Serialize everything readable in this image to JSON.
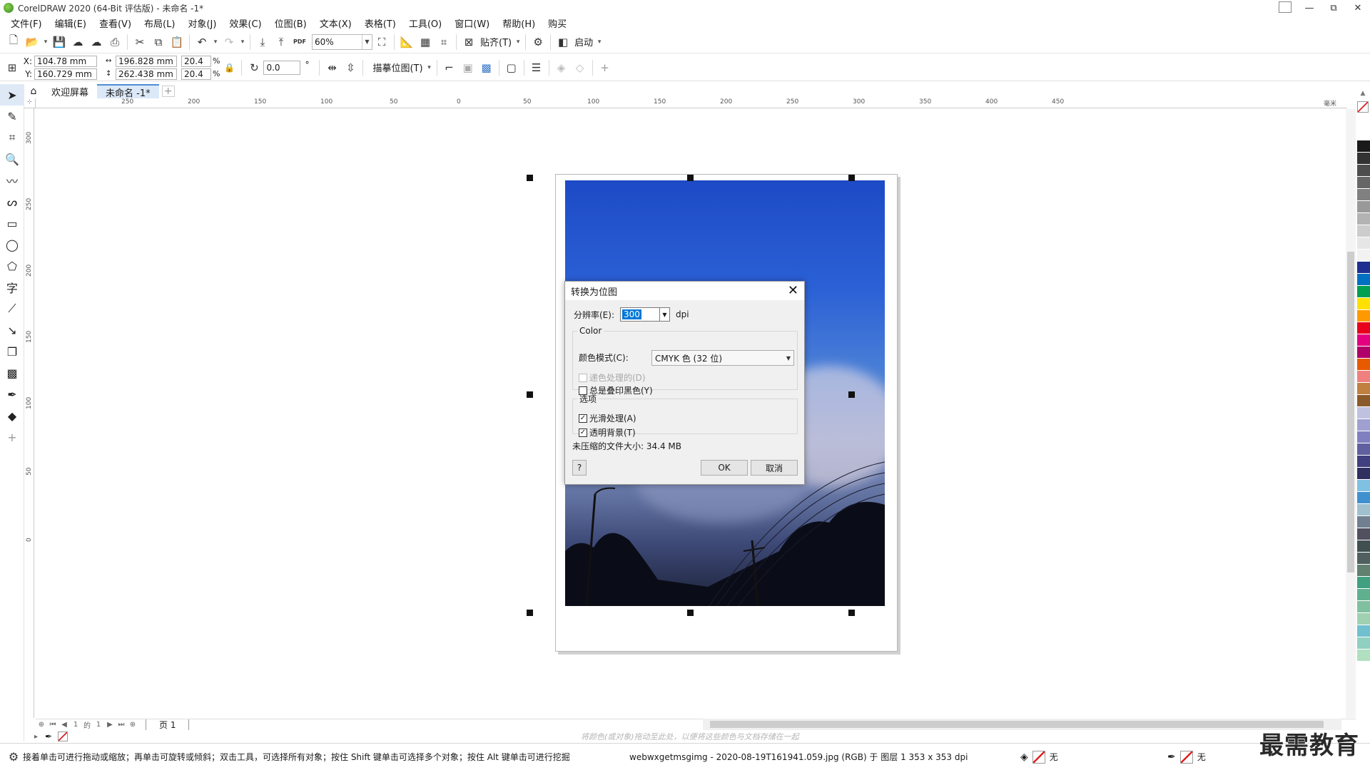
{
  "window": {
    "title": "CorelDRAW 2020 (64-Bit 评估版) - 未命名 -1*",
    "controls": [
      "—",
      "⧉",
      "✕"
    ]
  },
  "menu": [
    "文件(F)",
    "编辑(E)",
    "查看(V)",
    "布局(L)",
    "对象(J)",
    "效果(C)",
    "位图(B)",
    "文本(X)",
    "表格(T)",
    "工具(O)",
    "窗口(W)",
    "帮助(H)",
    "购买"
  ],
  "std_toolbar": {
    "zoom": "60%",
    "pdf_label": "PDF",
    "snap_label": "贴齐(T)",
    "launch_label": "启动"
  },
  "property_bar": {
    "x_label": "X:",
    "y_label": "Y:",
    "x_value": "104.78 mm",
    "y_value": "160.729 mm",
    "width_value": "196.828 mm",
    "height_value": "262.438 mm",
    "scale_x": "20.4",
    "scale_y": "20.4",
    "percent": "%",
    "rotation": "0.0",
    "rotation_unit": "°",
    "trace_label": "描摹位图(T)"
  },
  "tabs": {
    "welcome": "欢迎屏幕",
    "document": "未命名 -1*",
    "add": "+"
  },
  "ruler": {
    "h_labels": [
      "250",
      "200",
      "150",
      "100",
      "50",
      "0",
      "50",
      "100",
      "150",
      "200",
      "250",
      "300",
      "350",
      "400",
      "450"
    ],
    "h_unit": "毫米",
    "v_labels": [
      "300",
      "250",
      "200",
      "150",
      "100",
      "50",
      "0"
    ]
  },
  "dialog": {
    "title": "转换为位图",
    "resolution_label": "分辨率(E):",
    "resolution_value": "300",
    "resolution_unit": "dpi",
    "color_group": "Color",
    "color_mode_label": "颜色模式(C):",
    "color_mode_value": "CMYK 色  (32 位)",
    "dithered_label": "递色处理的(D)",
    "dithered_checked": false,
    "dithered_enabled": false,
    "overprint_label": "总是叠印黑色(Y)",
    "overprint_checked": false,
    "options_group": "选项",
    "antialias_label": "光滑处理(A)",
    "antialias_checked": true,
    "transparent_label": "透明背景(T)",
    "transparent_checked": true,
    "size_text": "未压缩的文件大小: 34.4 MB",
    "help_button": "?",
    "ok_button": "OK",
    "cancel_button": "取消"
  },
  "page_bar": {
    "page_count_text": "1",
    "page_of": "1",
    "page_tab": "页 1"
  },
  "color_hint": "将颜色(或对象)拖动至此处，以便将这些颜色与文档存储在一起",
  "status": {
    "hint": "接着单击可进行拖动或缩放；再单击可旋转或倾斜；双击工具，可选择所有对象；按住 Shift 键单击可选择多个对象；按住 Alt 键单击可进行挖掘",
    "file_info": "webwxgetmsgimg - 2020-08-19T161941.059.jpg (RGB) 于 图层 1 353 x 353 dpi",
    "fill_label": "无",
    "outline_label": "无"
  },
  "watermark": "最需教育",
  "palette_colors": [
    "#ffffff",
    "#1a1a1a",
    "#333333",
    "#4d4d4d",
    "#666666",
    "#808080",
    "#999999",
    "#b3b3b3",
    "#cccccc",
    "#e6e6e6",
    "#f2f2f2",
    "#1f2f8f",
    "#0070c0",
    "#00a050",
    "#ffe000",
    "#ff9900",
    "#e8001c",
    "#e4007f",
    "#b10069",
    "#e85a00",
    "#f08080",
    "#c08040",
    "#8b5a2b",
    "#c0c0e0",
    "#a0a0d0",
    "#8080c0",
    "#6060a0",
    "#404080",
    "#303060",
    "#80c0e0",
    "#4090d0",
    "#a0c0d0",
    "#708090",
    "#505060",
    "#405050",
    "#506060",
    "#608070",
    "#40a080",
    "#60b090",
    "#80c0a0",
    "#a0d0b0",
    "#70c0d0",
    "#90d0c0",
    "#b0e0c0"
  ]
}
